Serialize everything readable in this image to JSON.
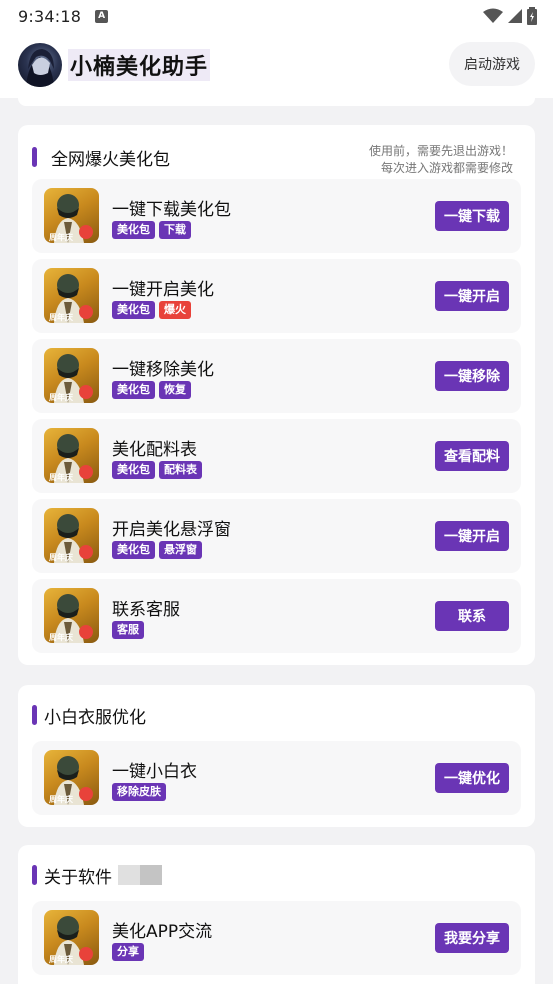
{
  "status_bar": {
    "time": "9:34:18",
    "badge": "A"
  },
  "header": {
    "title": "小楠美化助手",
    "launch_label": "启动游戏"
  },
  "sections": [
    {
      "title": "全网爆火美化包",
      "notice_line1": "使用前，需要先退出游戏！",
      "notice_line2": "每次进入游戏都需要修改",
      "items": [
        {
          "title": "一键下载美化包",
          "tags": [
            "美化包",
            "下载"
          ],
          "button": "一键下载"
        },
        {
          "title": "一键开启美化",
          "tags": [
            "美化包",
            "爆火"
          ],
          "button": "一键开启"
        },
        {
          "title": "一键移除美化",
          "tags": [
            "美化包",
            "恢复"
          ],
          "button": "一键移除"
        },
        {
          "title": "美化配料表",
          "tags": [
            "美化包",
            "配料表"
          ],
          "button": "查看配料"
        },
        {
          "title": "开启美化悬浮窗",
          "tags": [
            "美化包",
            "悬浮窗"
          ],
          "button": "一键开启"
        },
        {
          "title": "联系客服",
          "tags": [
            "客服"
          ],
          "button": "联系"
        }
      ]
    },
    {
      "title": "小白衣服优化",
      "items": [
        {
          "title": "一键小白衣",
          "tags": [
            "移除皮肤"
          ],
          "button": "一键优化"
        }
      ]
    },
    {
      "title": "关于软件",
      "items": [
        {
          "title": "美化APP交流",
          "tags": [
            "分享"
          ],
          "button": "我要分享"
        }
      ]
    }
  ],
  "icon_caption": "周年庆",
  "colors": {
    "accent": "#6a35b5",
    "hot_tag": "#e8423a",
    "background": "#f2f2f4"
  },
  "icons": [
    "wifi-icon",
    "signal-icon",
    "battery-icon",
    "avatar",
    "game-icon"
  ]
}
